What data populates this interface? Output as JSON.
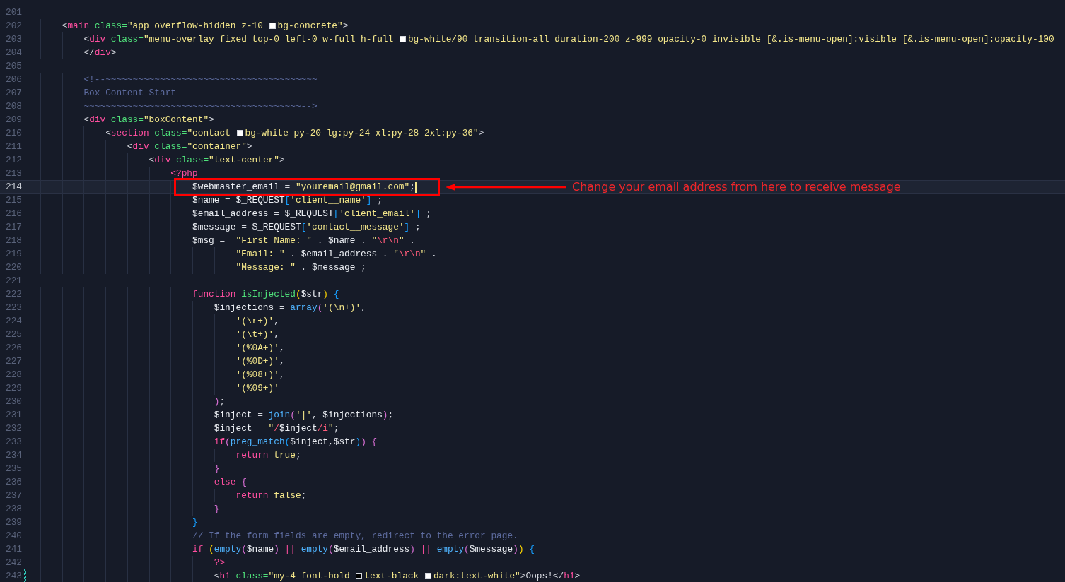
{
  "annotation": {
    "text": "Change your email address from here to receive message"
  },
  "lines": [
    {
      "number": "201",
      "current": false,
      "annotated": false,
      "modified": false
    },
    {
      "number": "202",
      "current": false,
      "annotated": false,
      "modified": false,
      "tokens": [
        {
          "kind": "punct",
          "text": "    <"
        },
        {
          "kind": "tag",
          "text": "main"
        },
        {
          "kind": "attr",
          "text": " class="
        },
        {
          "kind": "str",
          "text": "\"app overflow-hidden z-10 "
        },
        {
          "kind": "swatch",
          "color": "#ffffff"
        },
        {
          "kind": "str",
          "text": "bg-concrete\""
        },
        {
          "kind": "punct",
          "text": ">"
        }
      ]
    },
    {
      "number": "203",
      "current": false,
      "annotated": false,
      "modified": false,
      "tokens": [
        {
          "kind": "punct",
          "text": "        <"
        },
        {
          "kind": "tag",
          "text": "div"
        },
        {
          "kind": "attr",
          "text": " class="
        },
        {
          "kind": "str",
          "text": "\"menu-overlay fixed top-0 left-0 w-full h-full "
        },
        {
          "kind": "swatch",
          "color": "#ffffff"
        },
        {
          "kind": "str",
          "text": "bg-white/90 transition-all duration-200 z-999 opacity-0 invisible [&.is-menu-open]:visible [&.is-menu-open]:opacity-100"
        }
      ]
    },
    {
      "number": "204",
      "current": false,
      "annotated": false,
      "modified": false,
      "tokens": [
        {
          "kind": "punct",
          "text": "        </"
        },
        {
          "kind": "tag",
          "text": "div"
        },
        {
          "kind": "punct",
          "text": ">"
        }
      ]
    },
    {
      "number": "205",
      "current": false,
      "annotated": false,
      "modified": false
    },
    {
      "number": "206",
      "current": false,
      "annotated": false,
      "modified": false,
      "tokens": [
        {
          "kind": "comment",
          "text": "        <!--~~~~~~~~~~~~~~~~~~~~~~~~~~~~~~~~~~~~~~~"
        }
      ]
    },
    {
      "number": "207",
      "current": false,
      "annotated": false,
      "modified": false,
      "tokens": [
        {
          "kind": "comment",
          "text": "        Box Content Start"
        }
      ]
    },
    {
      "number": "208",
      "current": false,
      "annotated": false,
      "modified": false,
      "tokens": [
        {
          "kind": "comment",
          "text": "        ~~~~~~~~~~~~~~~~~~~~~~~~~~~~~~~~~~~~~~~~-->"
        }
      ]
    },
    {
      "number": "209",
      "current": false,
      "annotated": false,
      "modified": false,
      "tokens": [
        {
          "kind": "punct",
          "text": "        <"
        },
        {
          "kind": "tag",
          "text": "div"
        },
        {
          "kind": "attr",
          "text": " class="
        },
        {
          "kind": "str",
          "text": "\"boxContent\""
        },
        {
          "kind": "punct",
          "text": ">"
        }
      ]
    },
    {
      "number": "210",
      "current": false,
      "annotated": false,
      "modified": false,
      "tokens": [
        {
          "kind": "punct",
          "text": "            <"
        },
        {
          "kind": "tag",
          "text": "section"
        },
        {
          "kind": "attr",
          "text": " class="
        },
        {
          "kind": "str",
          "text": "\"contact "
        },
        {
          "kind": "swatch",
          "color": "#ffffff"
        },
        {
          "kind": "str",
          "text": "bg-white py-20 lg:py-24 xl:py-28 2xl:py-36\""
        },
        {
          "kind": "punct",
          "text": ">"
        }
      ]
    },
    {
      "number": "211",
      "current": false,
      "annotated": false,
      "modified": false,
      "tokens": [
        {
          "kind": "punct",
          "text": "                <"
        },
        {
          "kind": "tag",
          "text": "div"
        },
        {
          "kind": "attr",
          "text": " class="
        },
        {
          "kind": "str",
          "text": "\"container\""
        },
        {
          "kind": "punct",
          "text": ">"
        }
      ]
    },
    {
      "number": "212",
      "current": false,
      "annotated": false,
      "modified": false,
      "tokens": [
        {
          "kind": "punct",
          "text": "                    <"
        },
        {
          "kind": "tag",
          "text": "div"
        },
        {
          "kind": "attr",
          "text": " class="
        },
        {
          "kind": "str",
          "text": "\"text-center\""
        },
        {
          "kind": "punct",
          "text": ">"
        }
      ]
    },
    {
      "number": "213",
      "current": false,
      "annotated": false,
      "modified": false,
      "tokens": [
        {
          "kind": "keyword",
          "text": "                        <?php"
        }
      ]
    },
    {
      "number": "214",
      "current": true,
      "annotated": true,
      "modified": false,
      "tokens": [
        {
          "kind": "var",
          "text": "                            $webmaster_email"
        },
        {
          "kind": "punct",
          "text": " = "
        },
        {
          "kind": "str",
          "text": "\"youremail@gmail.com\""
        },
        {
          "kind": "punct",
          "text": ";"
        }
      ]
    },
    {
      "number": "215",
      "current": false,
      "annotated": false,
      "modified": false,
      "tokens": [
        {
          "kind": "var",
          "text": "                            $name"
        },
        {
          "kind": "punct",
          "text": " = "
        },
        {
          "kind": "var",
          "text": "$_REQUEST"
        },
        {
          "kind": "b3",
          "text": "["
        },
        {
          "kind": "str",
          "text": "'client__name'"
        },
        {
          "kind": "b3",
          "text": "]"
        },
        {
          "kind": "punct",
          "text": " ;"
        }
      ]
    },
    {
      "number": "216",
      "current": false,
      "annotated": false,
      "modified": false,
      "tokens": [
        {
          "kind": "var",
          "text": "                            $email_address"
        },
        {
          "kind": "punct",
          "text": " = "
        },
        {
          "kind": "var",
          "text": "$_REQUEST"
        },
        {
          "kind": "b3",
          "text": "["
        },
        {
          "kind": "str",
          "text": "'client_email'"
        },
        {
          "kind": "b3",
          "text": "]"
        },
        {
          "kind": "punct",
          "text": " ;"
        }
      ]
    },
    {
      "number": "217",
      "current": false,
      "annotated": false,
      "modified": false,
      "tokens": [
        {
          "kind": "var",
          "text": "                            $message"
        },
        {
          "kind": "punct",
          "text": " = "
        },
        {
          "kind": "var",
          "text": "$_REQUEST"
        },
        {
          "kind": "b3",
          "text": "["
        },
        {
          "kind": "str",
          "text": "'contact__message'"
        },
        {
          "kind": "b3",
          "text": "]"
        },
        {
          "kind": "punct",
          "text": " ;"
        }
      ]
    },
    {
      "number": "218",
      "current": false,
      "annotated": false,
      "modified": false,
      "tokens": [
        {
          "kind": "var",
          "text": "                            $msg"
        },
        {
          "kind": "punct",
          "text": " =  "
        },
        {
          "kind": "str",
          "text": "\"First Name: \""
        },
        {
          "kind": "punct",
          "text": " . "
        },
        {
          "kind": "var",
          "text": "$name"
        },
        {
          "kind": "punct",
          "text": " . "
        },
        {
          "kind": "str",
          "text": "\""
        },
        {
          "kind": "escape",
          "text": "\\r\\n"
        },
        {
          "kind": "str",
          "text": "\""
        },
        {
          "kind": "punct",
          "text": " ."
        }
      ]
    },
    {
      "number": "219",
      "current": false,
      "annotated": false,
      "modified": false,
      "tokens": [
        {
          "kind": "str",
          "text": "                                    \"Email: \""
        },
        {
          "kind": "punct",
          "text": " . "
        },
        {
          "kind": "var",
          "text": "$email_address"
        },
        {
          "kind": "punct",
          "text": " . "
        },
        {
          "kind": "str",
          "text": "\""
        },
        {
          "kind": "escape",
          "text": "\\r\\n"
        },
        {
          "kind": "str",
          "text": "\""
        },
        {
          "kind": "punct",
          "text": " ."
        }
      ]
    },
    {
      "number": "220",
      "current": false,
      "annotated": false,
      "modified": false,
      "tokens": [
        {
          "kind": "str",
          "text": "                                    \"Message: \""
        },
        {
          "kind": "punct",
          "text": " . "
        },
        {
          "kind": "var",
          "text": "$message"
        },
        {
          "kind": "punct",
          "text": " ;"
        }
      ]
    },
    {
      "number": "221",
      "current": false,
      "annotated": false,
      "modified": false
    },
    {
      "number": "222",
      "current": false,
      "annotated": false,
      "modified": false,
      "tokens": [
        {
          "kind": "keyword",
          "text": "                            function "
        },
        {
          "kind": "fn",
          "text": "isInjected"
        },
        {
          "kind": "b1",
          "text": "("
        },
        {
          "kind": "var",
          "text": "$str"
        },
        {
          "kind": "b1",
          "text": ") "
        },
        {
          "kind": "b3",
          "text": "{"
        }
      ]
    },
    {
      "number": "223",
      "current": false,
      "annotated": false,
      "modified": false,
      "tokens": [
        {
          "kind": "var",
          "text": "                                $injections"
        },
        {
          "kind": "punct",
          "text": " = "
        },
        {
          "kind": "builtin",
          "text": "array"
        },
        {
          "kind": "b2",
          "text": "("
        },
        {
          "kind": "str",
          "text": "'(\\n+)'"
        },
        {
          "kind": "punct",
          "text": ","
        }
      ]
    },
    {
      "number": "224",
      "current": false,
      "annotated": false,
      "modified": false,
      "tokens": [
        {
          "kind": "str",
          "text": "                                    '(\\r+)'"
        },
        {
          "kind": "punct",
          "text": ","
        }
      ]
    },
    {
      "number": "225",
      "current": false,
      "annotated": false,
      "modified": false,
      "tokens": [
        {
          "kind": "str",
          "text": "                                    '(\\t+)'"
        },
        {
          "kind": "punct",
          "text": ","
        }
      ]
    },
    {
      "number": "226",
      "current": false,
      "annotated": false,
      "modified": false,
      "tokens": [
        {
          "kind": "str",
          "text": "                                    '(%0A+)'"
        },
        {
          "kind": "punct",
          "text": ","
        }
      ]
    },
    {
      "number": "227",
      "current": false,
      "annotated": false,
      "modified": false,
      "tokens": [
        {
          "kind": "str",
          "text": "                                    '(%0D+)'"
        },
        {
          "kind": "punct",
          "text": ","
        }
      ]
    },
    {
      "number": "228",
      "current": false,
      "annotated": false,
      "modified": false,
      "tokens": [
        {
          "kind": "str",
          "text": "                                    '(%08+)'"
        },
        {
          "kind": "punct",
          "text": ","
        }
      ]
    },
    {
      "number": "229",
      "current": false,
      "annotated": false,
      "modified": false,
      "tokens": [
        {
          "kind": "str",
          "text": "                                    '(%09+)'"
        }
      ]
    },
    {
      "number": "230",
      "current": false,
      "annotated": false,
      "modified": false,
      "tokens": [
        {
          "kind": "b2",
          "text": "                                )"
        },
        {
          "kind": "punct",
          "text": ";"
        }
      ]
    },
    {
      "number": "231",
      "current": false,
      "annotated": false,
      "modified": false,
      "tokens": [
        {
          "kind": "var",
          "text": "                                $inject"
        },
        {
          "kind": "punct",
          "text": " = "
        },
        {
          "kind": "builtin",
          "text": "join"
        },
        {
          "kind": "b2",
          "text": "("
        },
        {
          "kind": "str",
          "text": "'|'"
        },
        {
          "kind": "punct",
          "text": ", "
        },
        {
          "kind": "var",
          "text": "$injections"
        },
        {
          "kind": "b2",
          "text": ")"
        },
        {
          "kind": "punct",
          "text": ";"
        }
      ]
    },
    {
      "number": "232",
      "current": false,
      "annotated": false,
      "modified": false,
      "tokens": [
        {
          "kind": "var",
          "text": "                                $inject"
        },
        {
          "kind": "punct",
          "text": " = "
        },
        {
          "kind": "str",
          "text": "\""
        },
        {
          "kind": "escape",
          "text": "/"
        },
        {
          "kind": "var",
          "text": "$inject"
        },
        {
          "kind": "escape",
          "text": "/i"
        },
        {
          "kind": "str",
          "text": "\""
        },
        {
          "kind": "punct",
          "text": ";"
        }
      ]
    },
    {
      "number": "233",
      "current": false,
      "annotated": false,
      "modified": false,
      "tokens": [
        {
          "kind": "keyword",
          "text": "                                if"
        },
        {
          "kind": "b2",
          "text": "("
        },
        {
          "kind": "builtin",
          "text": "preg_match"
        },
        {
          "kind": "b3",
          "text": "("
        },
        {
          "kind": "var",
          "text": "$inject,$str"
        },
        {
          "kind": "b3",
          "text": ")"
        },
        {
          "kind": "b2",
          "text": ") {"
        }
      ]
    },
    {
      "number": "234",
      "current": false,
      "annotated": false,
      "modified": false,
      "tokens": [
        {
          "kind": "keyword",
          "text": "                                    return "
        },
        {
          "kind": "const",
          "text": "true"
        },
        {
          "kind": "punct",
          "text": ";"
        }
      ]
    },
    {
      "number": "235",
      "current": false,
      "annotated": false,
      "modified": false,
      "tokens": [
        {
          "kind": "b2",
          "text": "                                }"
        }
      ]
    },
    {
      "number": "236",
      "current": false,
      "annotated": false,
      "modified": false,
      "tokens": [
        {
          "kind": "keyword",
          "text": "                                else "
        },
        {
          "kind": "b2",
          "text": "{"
        }
      ]
    },
    {
      "number": "237",
      "current": false,
      "annotated": false,
      "modified": false,
      "tokens": [
        {
          "kind": "keyword",
          "text": "                                    return "
        },
        {
          "kind": "const",
          "text": "false"
        },
        {
          "kind": "punct",
          "text": ";"
        }
      ]
    },
    {
      "number": "238",
      "current": false,
      "annotated": false,
      "modified": false,
      "tokens": [
        {
          "kind": "b2",
          "text": "                                }"
        }
      ]
    },
    {
      "number": "239",
      "current": false,
      "annotated": false,
      "modified": false,
      "tokens": [
        {
          "kind": "b3",
          "text": "                            }"
        }
      ]
    },
    {
      "number": "240",
      "current": false,
      "annotated": false,
      "modified": false,
      "tokens": [
        {
          "kind": "comment",
          "text": "                            // If the form fields are empty, redirect to the error page."
        }
      ]
    },
    {
      "number": "241",
      "current": false,
      "annotated": false,
      "modified": false,
      "tokens": [
        {
          "kind": "keyword",
          "text": "                            if "
        },
        {
          "kind": "b1",
          "text": "("
        },
        {
          "kind": "builtin",
          "text": "empty"
        },
        {
          "kind": "b2",
          "text": "("
        },
        {
          "kind": "var",
          "text": "$name"
        },
        {
          "kind": "b2",
          "text": ") "
        },
        {
          "kind": "keyword",
          "text": "|| "
        },
        {
          "kind": "builtin",
          "text": "empty"
        },
        {
          "kind": "b2",
          "text": "("
        },
        {
          "kind": "var",
          "text": "$email_address"
        },
        {
          "kind": "b2",
          "text": ") "
        },
        {
          "kind": "keyword",
          "text": "|| "
        },
        {
          "kind": "builtin",
          "text": "empty"
        },
        {
          "kind": "b2",
          "text": "("
        },
        {
          "kind": "var",
          "text": "$message"
        },
        {
          "kind": "b2",
          "text": ")"
        },
        {
          "kind": "b1",
          "text": ") "
        },
        {
          "kind": "b3",
          "text": "{"
        }
      ]
    },
    {
      "number": "242",
      "current": false,
      "annotated": false,
      "modified": false,
      "tokens": [
        {
          "kind": "keyword",
          "text": "                                ?>"
        }
      ]
    },
    {
      "number": "243",
      "current": false,
      "annotated": false,
      "modified": true,
      "tokens": [
        {
          "kind": "punct",
          "text": "                                <"
        },
        {
          "kind": "tag",
          "text": "h1"
        },
        {
          "kind": "attr",
          "text": " class="
        },
        {
          "kind": "str",
          "text": "\"my-4 font-bold "
        },
        {
          "kind": "swatch",
          "color": "#000000"
        },
        {
          "kind": "str",
          "text": "text-black "
        },
        {
          "kind": "swatch",
          "color": "#ffffff"
        },
        {
          "kind": "str",
          "text": "dark:text-white\""
        },
        {
          "kind": "punct",
          "text": ">Oops!</"
        },
        {
          "kind": "tag",
          "text": "h1"
        },
        {
          "kind": "punct",
          "text": ">"
        }
      ]
    }
  ]
}
